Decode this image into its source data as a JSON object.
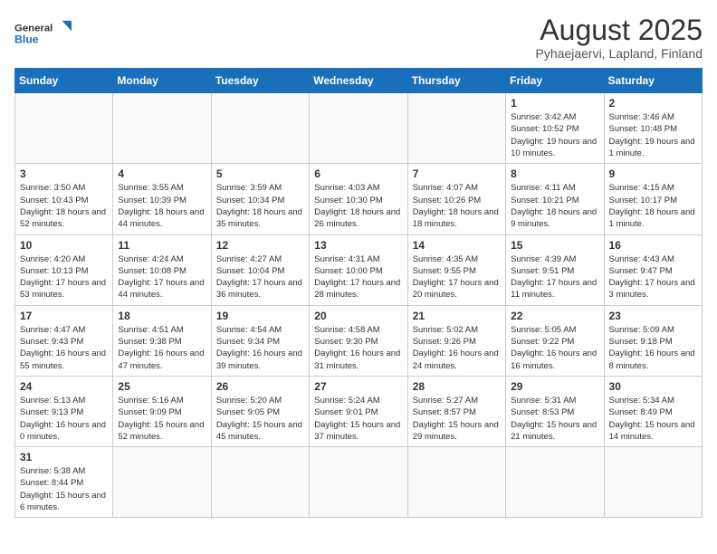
{
  "header": {
    "logo_general": "General",
    "logo_blue": "Blue",
    "title": "August 2025",
    "subtitle": "Pyhaejaervi, Lapland, Finland"
  },
  "weekdays": [
    "Sunday",
    "Monday",
    "Tuesday",
    "Wednesday",
    "Thursday",
    "Friday",
    "Saturday"
  ],
  "weeks": [
    [
      {
        "day": "",
        "info": ""
      },
      {
        "day": "",
        "info": ""
      },
      {
        "day": "",
        "info": ""
      },
      {
        "day": "",
        "info": ""
      },
      {
        "day": "",
        "info": ""
      },
      {
        "day": "1",
        "info": "Sunrise: 3:42 AM\nSunset: 10:52 PM\nDaylight: 19 hours and 10 minutes."
      },
      {
        "day": "2",
        "info": "Sunrise: 3:46 AM\nSunset: 10:48 PM\nDaylight: 19 hours and 1 minute."
      }
    ],
    [
      {
        "day": "3",
        "info": "Sunrise: 3:50 AM\nSunset: 10:43 PM\nDaylight: 18 hours and 52 minutes."
      },
      {
        "day": "4",
        "info": "Sunrise: 3:55 AM\nSunset: 10:39 PM\nDaylight: 18 hours and 44 minutes."
      },
      {
        "day": "5",
        "info": "Sunrise: 3:59 AM\nSunset: 10:34 PM\nDaylight: 18 hours and 35 minutes."
      },
      {
        "day": "6",
        "info": "Sunrise: 4:03 AM\nSunset: 10:30 PM\nDaylight: 18 hours and 26 minutes."
      },
      {
        "day": "7",
        "info": "Sunrise: 4:07 AM\nSunset: 10:26 PM\nDaylight: 18 hours and 18 minutes."
      },
      {
        "day": "8",
        "info": "Sunrise: 4:11 AM\nSunset: 10:21 PM\nDaylight: 18 hours and 9 minutes."
      },
      {
        "day": "9",
        "info": "Sunrise: 4:15 AM\nSunset: 10:17 PM\nDaylight: 18 hours and 1 minute."
      }
    ],
    [
      {
        "day": "10",
        "info": "Sunrise: 4:20 AM\nSunset: 10:13 PM\nDaylight: 17 hours and 53 minutes."
      },
      {
        "day": "11",
        "info": "Sunrise: 4:24 AM\nSunset: 10:08 PM\nDaylight: 17 hours and 44 minutes."
      },
      {
        "day": "12",
        "info": "Sunrise: 4:27 AM\nSunset: 10:04 PM\nDaylight: 17 hours and 36 minutes."
      },
      {
        "day": "13",
        "info": "Sunrise: 4:31 AM\nSunset: 10:00 PM\nDaylight: 17 hours and 28 minutes."
      },
      {
        "day": "14",
        "info": "Sunrise: 4:35 AM\nSunset: 9:55 PM\nDaylight: 17 hours and 20 minutes."
      },
      {
        "day": "15",
        "info": "Sunrise: 4:39 AM\nSunset: 9:51 PM\nDaylight: 17 hours and 11 minutes."
      },
      {
        "day": "16",
        "info": "Sunrise: 4:43 AM\nSunset: 9:47 PM\nDaylight: 17 hours and 3 minutes."
      }
    ],
    [
      {
        "day": "17",
        "info": "Sunrise: 4:47 AM\nSunset: 9:43 PM\nDaylight: 16 hours and 55 minutes."
      },
      {
        "day": "18",
        "info": "Sunrise: 4:51 AM\nSunset: 9:38 PM\nDaylight: 16 hours and 47 minutes."
      },
      {
        "day": "19",
        "info": "Sunrise: 4:54 AM\nSunset: 9:34 PM\nDaylight: 16 hours and 39 minutes."
      },
      {
        "day": "20",
        "info": "Sunrise: 4:58 AM\nSunset: 9:30 PM\nDaylight: 16 hours and 31 minutes."
      },
      {
        "day": "21",
        "info": "Sunrise: 5:02 AM\nSunset: 9:26 PM\nDaylight: 16 hours and 24 minutes."
      },
      {
        "day": "22",
        "info": "Sunrise: 5:05 AM\nSunset: 9:22 PM\nDaylight: 16 hours and 16 minutes."
      },
      {
        "day": "23",
        "info": "Sunrise: 5:09 AM\nSunset: 9:18 PM\nDaylight: 16 hours and 8 minutes."
      }
    ],
    [
      {
        "day": "24",
        "info": "Sunrise: 5:13 AM\nSunset: 9:13 PM\nDaylight: 16 hours and 0 minutes."
      },
      {
        "day": "25",
        "info": "Sunrise: 5:16 AM\nSunset: 9:09 PM\nDaylight: 15 hours and 52 minutes."
      },
      {
        "day": "26",
        "info": "Sunrise: 5:20 AM\nSunset: 9:05 PM\nDaylight: 15 hours and 45 minutes."
      },
      {
        "day": "27",
        "info": "Sunrise: 5:24 AM\nSunset: 9:01 PM\nDaylight: 15 hours and 37 minutes."
      },
      {
        "day": "28",
        "info": "Sunrise: 5:27 AM\nSunset: 8:57 PM\nDaylight: 15 hours and 29 minutes."
      },
      {
        "day": "29",
        "info": "Sunrise: 5:31 AM\nSunset: 8:53 PM\nDaylight: 15 hours and 21 minutes."
      },
      {
        "day": "30",
        "info": "Sunrise: 5:34 AM\nSunset: 8:49 PM\nDaylight: 15 hours and 14 minutes."
      }
    ],
    [
      {
        "day": "31",
        "info": "Sunrise: 5:38 AM\nSunset: 8:44 PM\nDaylight: 15 hours and 6 minutes."
      },
      {
        "day": "",
        "info": ""
      },
      {
        "day": "",
        "info": ""
      },
      {
        "day": "",
        "info": ""
      },
      {
        "day": "",
        "info": ""
      },
      {
        "day": "",
        "info": ""
      },
      {
        "day": "",
        "info": ""
      }
    ]
  ]
}
